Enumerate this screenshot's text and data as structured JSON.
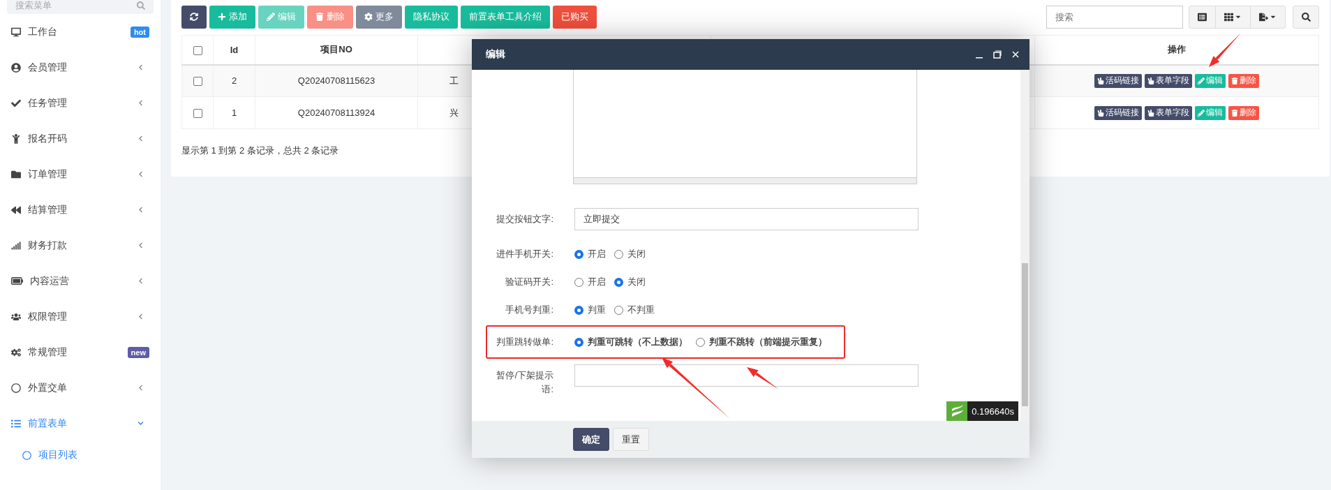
{
  "sidebar": {
    "search": {
      "placeholder": "搜索菜单"
    },
    "items": [
      {
        "label": "工作台",
        "badge": {
          "text": "hot",
          "color": "#2d8cf0"
        },
        "selected": false
      },
      {
        "label": "会员管理",
        "expanded": false,
        "selected": false
      },
      {
        "label": "任务管理",
        "expanded": false,
        "selected": false
      },
      {
        "label": "报名开码",
        "expanded": false,
        "selected": false
      },
      {
        "label": "订单管理",
        "expanded": false,
        "selected": false
      },
      {
        "label": "结算管理",
        "expanded": false,
        "selected": false
      },
      {
        "label": "财务打款",
        "expanded": false,
        "selected": false
      },
      {
        "label": "内容运营",
        "expanded": false,
        "selected": false
      },
      {
        "label": "权限管理",
        "expanded": false,
        "selected": false
      },
      {
        "label": "常规管理",
        "badge": {
          "text": "new",
          "color": "#605ca8"
        },
        "selected": false
      },
      {
        "label": "外置交单",
        "expanded": false,
        "selected": false
      },
      {
        "label": "前置表单",
        "expanded": true,
        "selected": true,
        "children": [
          {
            "label": "项目列表",
            "selected": true
          }
        ]
      }
    ]
  },
  "toolbar": {
    "buttons": [
      {
        "kind": "refresh",
        "disabled": false
      },
      {
        "kind": "add",
        "label": "添加",
        "disabled": false
      },
      {
        "kind": "edit",
        "label": "编辑",
        "disabled": true
      },
      {
        "kind": "delete",
        "label": "删除",
        "disabled": true
      },
      {
        "kind": "more",
        "label": "更多",
        "disabled": false
      },
      {
        "kind": "plain",
        "label": "隐私协议",
        "disabled": false
      },
      {
        "kind": "plain",
        "label": "前置表单工具介绍",
        "disabled": false
      },
      {
        "kind": "bought",
        "label": "已购买",
        "disabled": false
      }
    ],
    "search": {
      "placeholder": "搜索"
    }
  },
  "table": {
    "header_checked": false,
    "columns": [
      "Id",
      "项目NO",
      "操作"
    ],
    "rows": [
      {
        "checked": false,
        "id": "2",
        "project_no": "Q20240708115623",
        "column_4": "工",
        "actions": [
          {
            "kind": "link",
            "label": "活码链接"
          },
          {
            "kind": "link",
            "label": "表单字段"
          },
          {
            "kind": "edit",
            "label": "编辑"
          },
          {
            "kind": "delete",
            "label": "删除"
          }
        ]
      },
      {
        "checked": false,
        "id": "1",
        "project_no": "Q20240708113924",
        "column_4": "兴",
        "actions": [
          {
            "kind": "link",
            "label": "活码链接"
          },
          {
            "kind": "link",
            "label": "表单字段"
          },
          {
            "kind": "edit",
            "label": "编辑"
          },
          {
            "kind": "delete",
            "label": "删除"
          }
        ]
      }
    ],
    "summary": "显示第 1 到第 2 条记录，总共 2 条记录"
  },
  "dialog": {
    "title": "编辑",
    "fields": [
      {
        "kind": "textarea"
      },
      {
        "kind": "text",
        "label": "提交按钮文字:",
        "value": "立即提交"
      },
      {
        "kind": "radio",
        "label": "进件手机开关:",
        "options": [
          {
            "label": "开启",
            "selected": true
          },
          {
            "label": "关闭",
            "selected": false
          }
        ]
      },
      {
        "kind": "radio",
        "label": "验证码开关:",
        "options": [
          {
            "label": "开启",
            "selected": false
          },
          {
            "label": "关闭",
            "selected": true
          }
        ]
      },
      {
        "kind": "radio",
        "label": "手机号判重:",
        "options": [
          {
            "label": "判重",
            "selected": true
          },
          {
            "label": "不判重",
            "selected": false
          }
        ]
      },
      {
        "kind": "radio",
        "label": "判重跳转做单:",
        "highlighted": true,
        "options": [
          {
            "label": "判重可跳转（不上数据）",
            "selected": true
          },
          {
            "label": "判重不跳转（前端提示重复）",
            "selected": false
          }
        ]
      },
      {
        "kind": "text",
        "label": "暂停/下架提示语:"
      }
    ],
    "timer": "0.196640s",
    "buttons": [
      {
        "kind": "primary",
        "label": "确定"
      },
      {
        "kind": "default",
        "label": "重置"
      }
    ]
  }
}
